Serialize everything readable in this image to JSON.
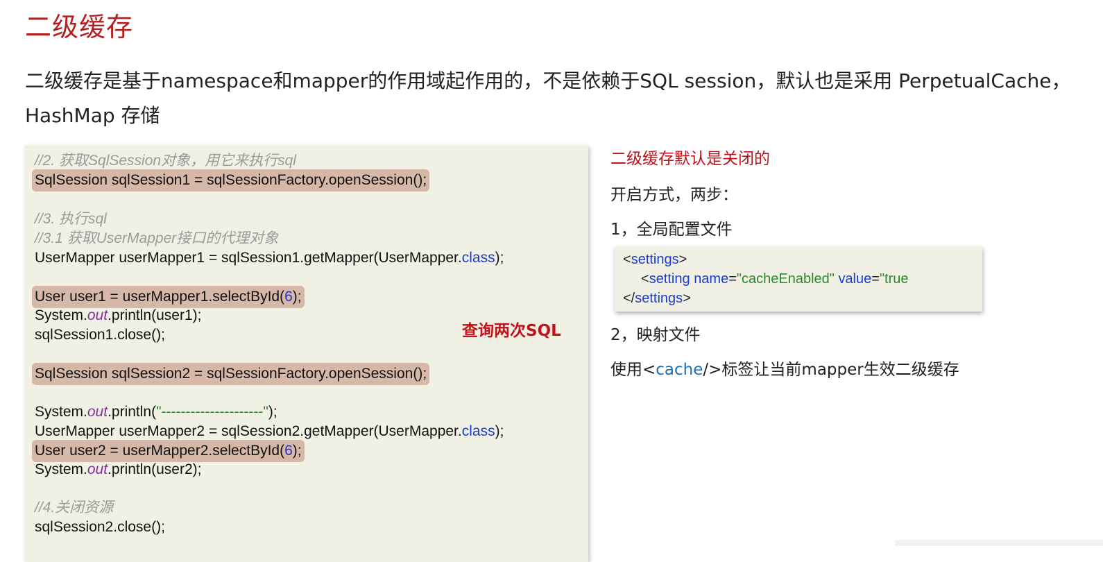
{
  "title": "二级缓存",
  "intro": "二级缓存是基于namespace和mapper的作用域起作用的，不是依赖于SQL session，默认也是采用 PerpetualCache，HashMap 存储",
  "code": {
    "c1": "//2. 获取SqlSession对象，用它来执行sql",
    "l1": "SqlSession sqlSession1 = sqlSessionFactory.openSession();",
    "c2": "//3. 执行sql",
    "c3": "//3.1 获取UserMapper接口的代理对象",
    "l2a": "UserMapper userMapper1 = sqlSession1.getMapper(UserMapper.",
    "l2kw": "class",
    "l2b": ");",
    "l3a": "User user1 = userMapper1.selectById(",
    "l3n": "6",
    "l3b": ");",
    "l4a": "System.",
    "l4kw": "out",
    "l4b": ".println(user1);",
    "l5": "sqlSession1.close();",
    "l6": "SqlSession sqlSession2 = sqlSessionFactory.openSession();",
    "l7a": "System.",
    "l7kw": "out",
    "l7b": ".println(",
    "l7s": "\"---------------------\"",
    "l7c": ");",
    "l8a": "UserMapper userMapper2 = sqlSession2.getMapper(UserMapper.",
    "l8kw": "class",
    "l8b": ");",
    "l9a": "User user2 = userMapper2.selectById(",
    "l9n": "6",
    "l9b": ");",
    "l10a": "System.",
    "l10kw": "out",
    "l10b": ".println(user2);",
    "c4": "//4.关闭资源",
    "l11": "sqlSession2.close();"
  },
  "note": "查询两次SQL",
  "right": {
    "heading": "二级缓存默认是关闭的",
    "step_intro": "开启方式，两步：",
    "step1": "1，全局配置文件",
    "xml": {
      "line1_open": "<",
      "line1_tag": "settings",
      "line1_close": ">",
      "line2_open": "<",
      "line2_tag": "setting",
      "line2_attr1": "name",
      "line2_eq1": "=",
      "line2_val1": "\"cacheEnabled\"",
      "line2_attr2": "value",
      "line2_eq2": "=",
      "line2_val2": "\"true",
      "line3_open": "</",
      "line3_tag": "settings",
      "line3_close": ">"
    },
    "step2": "2，映射文件",
    "usage_before": "使用<",
    "usage_tag": "cache",
    "usage_after": "/>标签让当前mapper生效二级缓存"
  },
  "colors": {
    "title": "#b22222",
    "note": "#c0131a",
    "highlight": "#d6b8a8",
    "panel": "#f0f1e4"
  }
}
